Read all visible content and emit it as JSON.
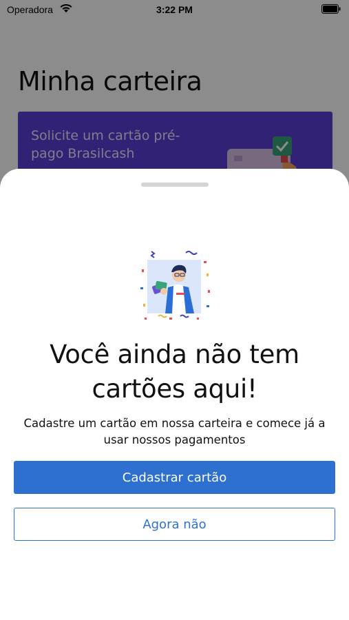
{
  "status_bar": {
    "carrier": "Operadora",
    "time": "3:22 PM"
  },
  "background": {
    "page_title": "Minha carteira",
    "promo_text": "Solicite um cartão pré-pago Brasilcash"
  },
  "sheet": {
    "title": "Você ainda não tem cartões aqui!",
    "subtitle": "Cadastre um cartão em nossa carteira e comece já a usar nossos pagamentos",
    "primary_button": "Cadastrar cartão",
    "secondary_button": "Agora não"
  },
  "colors": {
    "primary": "#2e70d0",
    "promo_card": "#5b3fd6",
    "overlay": "rgba(0,0,0,0.45)"
  },
  "icons": {
    "wifi": "wifi-icon",
    "battery": "battery-icon",
    "illustration": "person-with-cards-illustration",
    "card": "card-illustration"
  }
}
